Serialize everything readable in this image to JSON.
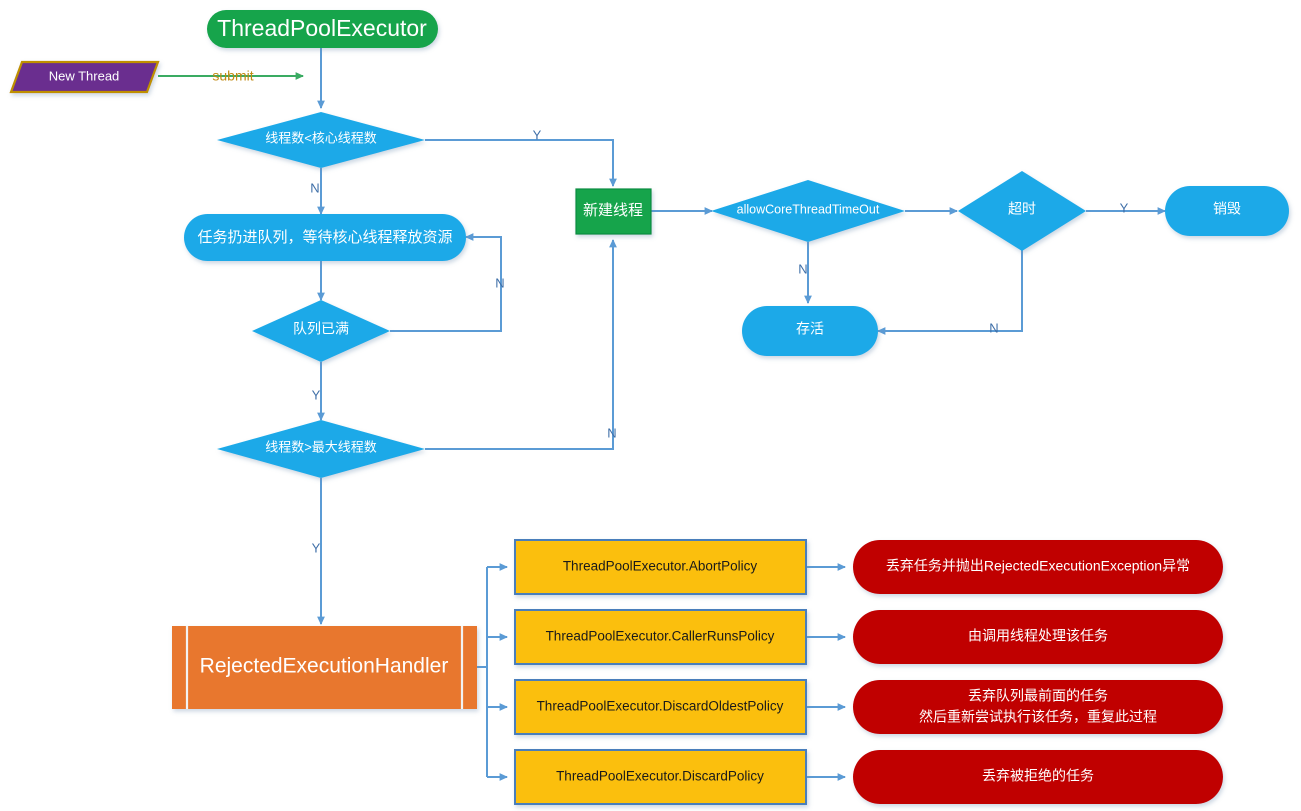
{
  "diagram": {
    "title": "ThreadPoolExecutor flow",
    "colors": {
      "green": "#13A44C",
      "purple": "#6B2D8F",
      "purple_border": "#BF9000",
      "blue": "#1CA9E8",
      "orange": "#E8772E",
      "yellow": "#FBBF07",
      "yellow_border": "#4A7EBB",
      "red": "#C00000",
      "connector": "#5B9BD5",
      "connector_green": "#3AAB62",
      "label_blue": "#3F6FA8",
      "label_gold": "#C08A12"
    },
    "nodes": {
      "thread_pool_executor": "ThreadPoolExecutor",
      "new_thread": "New Thread",
      "decision_core": "线程数<核心线程数",
      "queue_task": "任务扔进队列，等待核心线程释放资源",
      "decision_queue_full": "队列已满",
      "decision_max": "线程数>最大线程数",
      "create_thread": "新建线程",
      "decision_allow_core_timeout": "allowCoreThreadTimeOut",
      "decision_timeout": "超时",
      "destroy": "销毁",
      "alive": "存活",
      "rejected_handler": "RejectedExecutionHandler"
    },
    "edge_labels": {
      "submit": "submit",
      "core_yes": "Y",
      "core_no": "N",
      "queue_full_no": "N",
      "queue_full_yes": "Y",
      "max_no": "N",
      "max_yes": "Y",
      "allow_core_no": "N",
      "timeout_yes": "Y",
      "timeout_no": "N"
    },
    "policies": [
      {
        "name": "ThreadPoolExecutor.AbortPolicy",
        "description": "丢弃任务并抛出RejectedExecutionException异常",
        "description_line2": ""
      },
      {
        "name": "ThreadPoolExecutor.CallerRunsPolicy",
        "description": "由调用线程处理该任务",
        "description_line2": ""
      },
      {
        "name": "ThreadPoolExecutor.DiscardOldestPolicy",
        "description": "丢弃队列最前面的任务",
        "description_line2": "然后重新尝试执行该任务，重复此过程"
      },
      {
        "name": "ThreadPoolExecutor.DiscardPolicy",
        "description": "丢弃被拒绝的任务",
        "description_line2": ""
      }
    ]
  }
}
